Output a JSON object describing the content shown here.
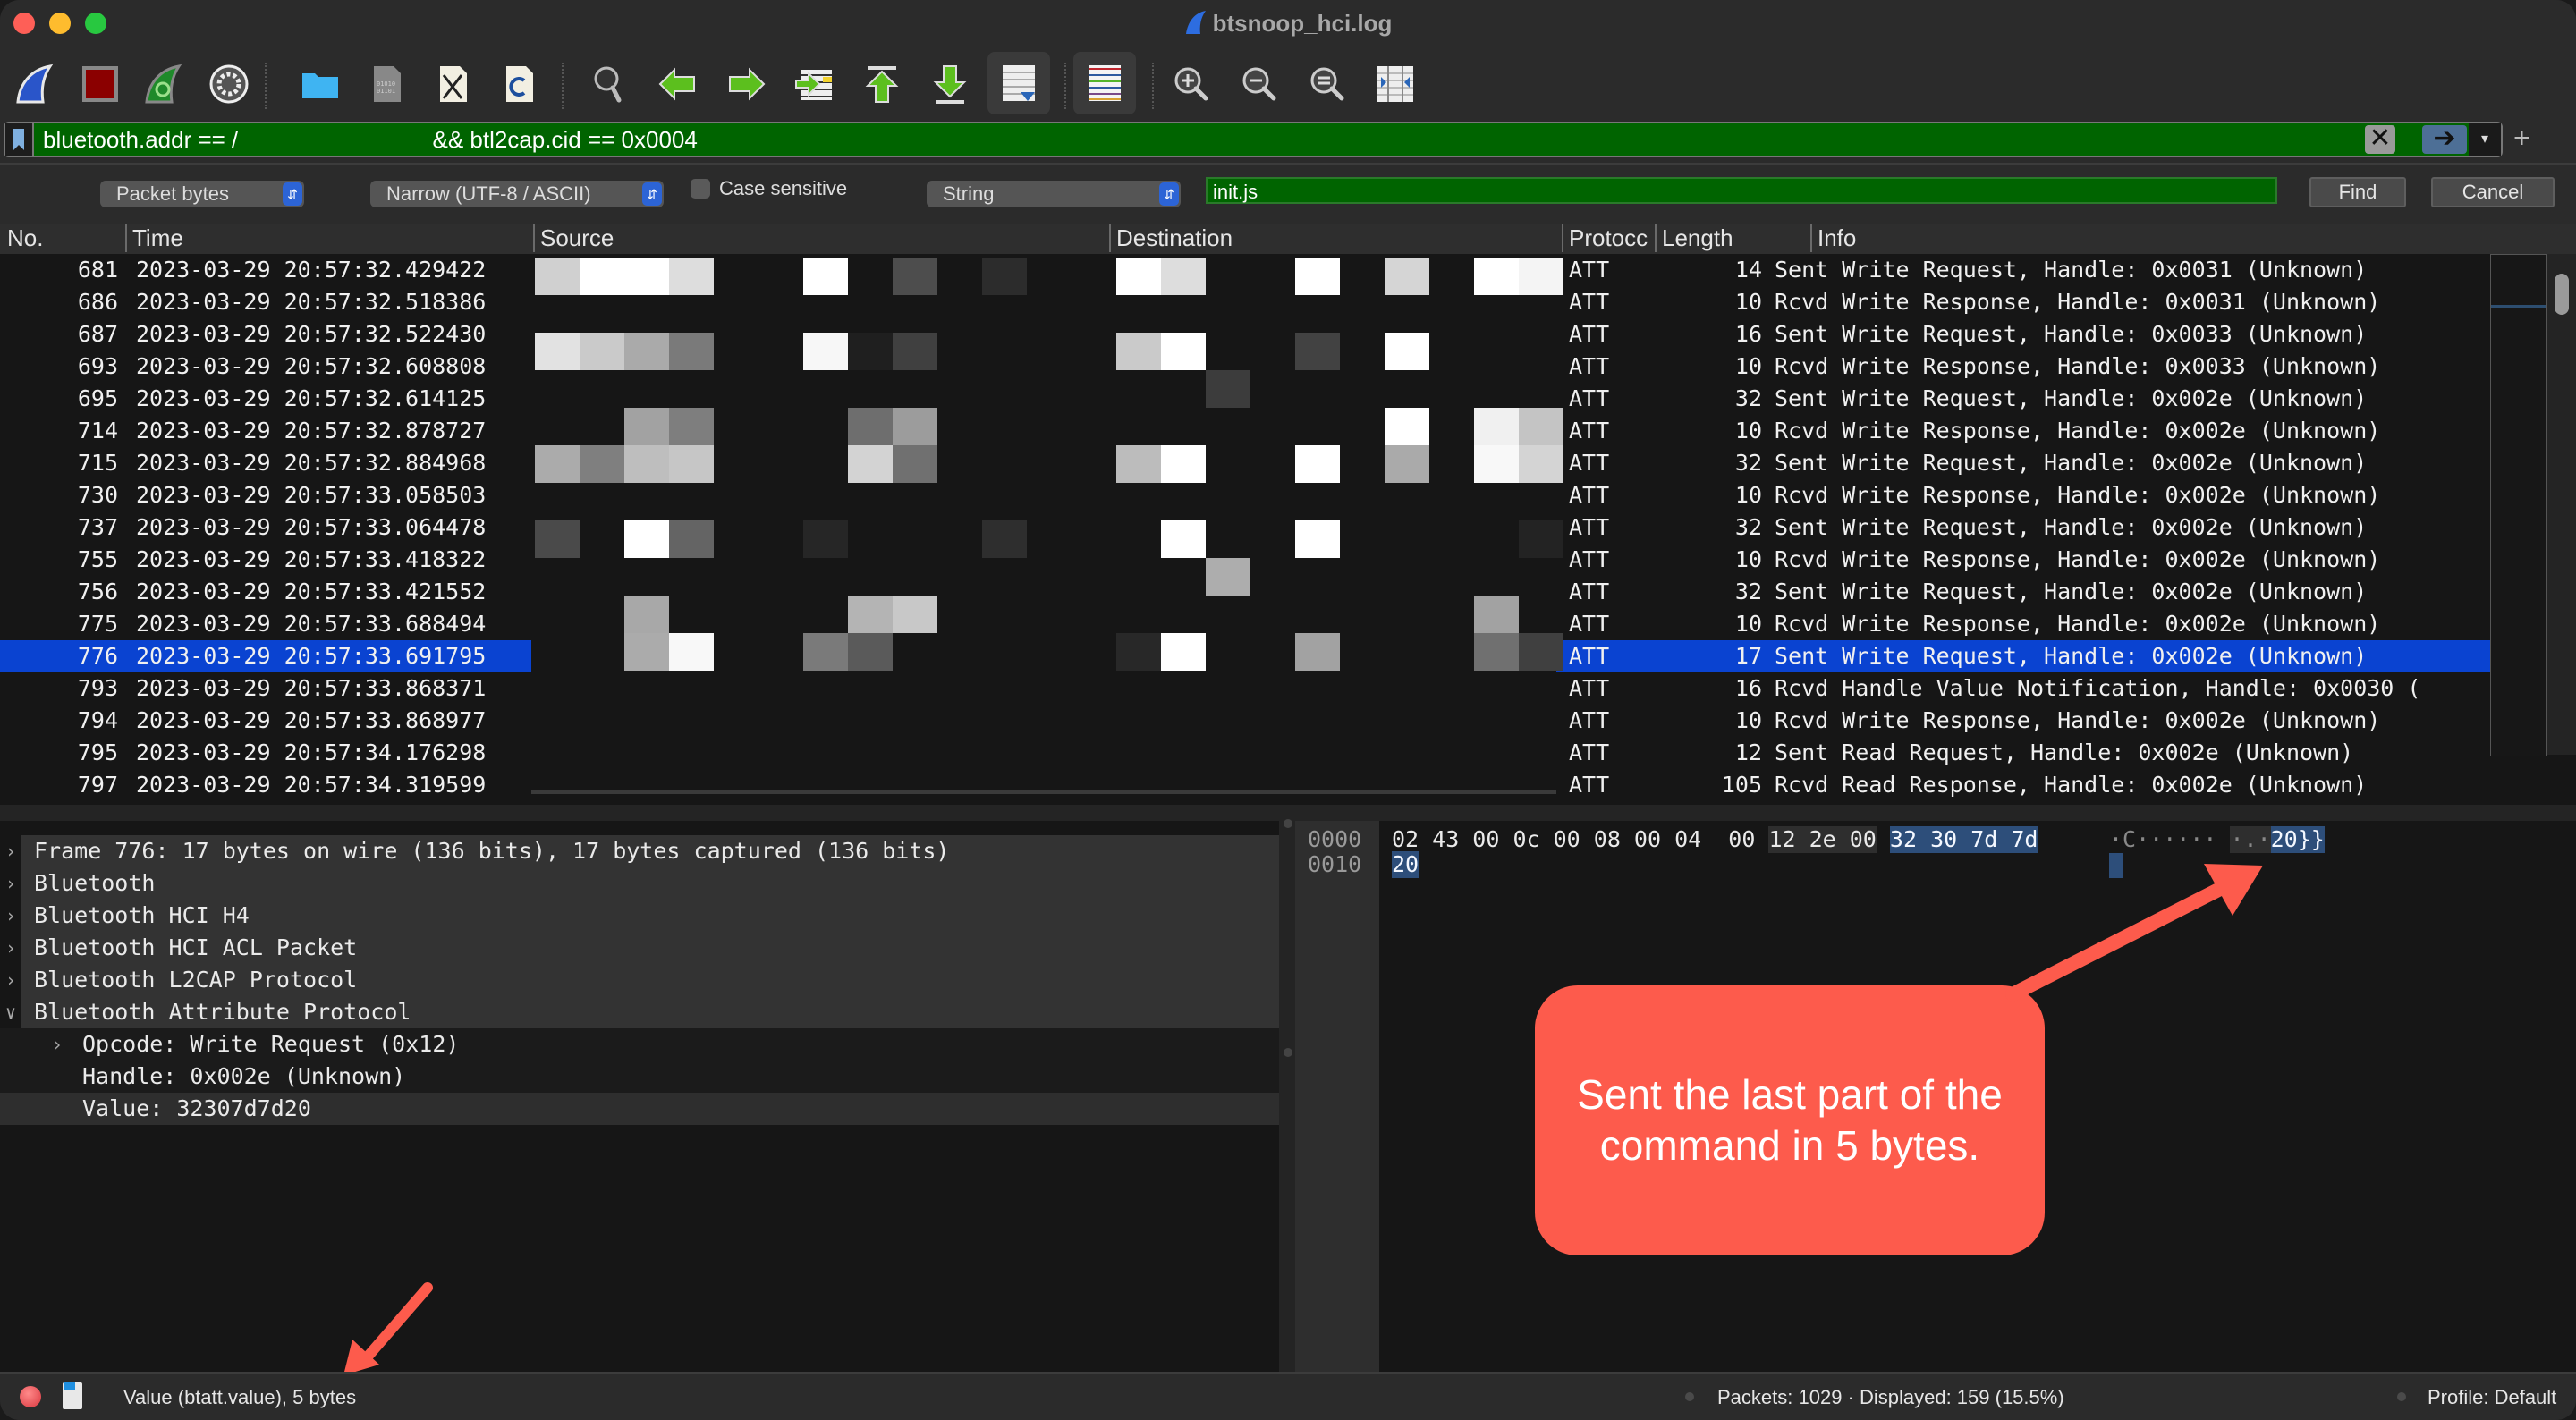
{
  "window": {
    "title": "btsnoop_hci.log"
  },
  "toolbar": {
    "buttons": [
      {
        "name": "start-capture",
        "icon": "shark-fin-icon"
      },
      {
        "name": "stop-capture",
        "icon": "stop-square-icon"
      },
      {
        "name": "restart-capture",
        "icon": "restart-fin-icon"
      },
      {
        "name": "capture-options",
        "icon": "gear-icon"
      },
      {
        "name": "open-file",
        "icon": "folder-icon"
      },
      {
        "name": "save-file",
        "icon": "binary-file-icon"
      },
      {
        "name": "close-file",
        "icon": "close-file-icon"
      },
      {
        "name": "reload-file",
        "icon": "reload-file-icon"
      },
      {
        "name": "find-packet",
        "icon": "magnifier-icon"
      },
      {
        "name": "go-back",
        "icon": "arrow-left-icon"
      },
      {
        "name": "go-forward",
        "icon": "arrow-right-icon"
      },
      {
        "name": "go-to-packet",
        "icon": "jump-to-packet-icon"
      },
      {
        "name": "go-first",
        "icon": "arrow-up-first-icon"
      },
      {
        "name": "go-last",
        "icon": "arrow-down-last-icon"
      },
      {
        "name": "auto-scroll",
        "icon": "auto-scroll-icon",
        "pressed": true
      },
      {
        "name": "colorize",
        "icon": "colorize-lines-icon",
        "pressed": true
      },
      {
        "name": "zoom-in",
        "icon": "zoom-in-icon"
      },
      {
        "name": "zoom-out",
        "icon": "zoom-out-icon"
      },
      {
        "name": "normal-size",
        "icon": "zoom-reset-icon"
      },
      {
        "name": "resize-columns",
        "icon": "resize-columns-icon"
      }
    ]
  },
  "filter": {
    "prefix": "bluetooth.addr == /",
    "suffix": " && btl2cap.cid == 0x0004",
    "clear_icon": "✕",
    "apply_icon": "➔",
    "dropdown_icon": "▾",
    "add_icon": "+"
  },
  "find": {
    "search_in": "Packet bytes",
    "char_width": "Narrow (UTF-8 / ASCII)",
    "case_sensitive_label": "Case sensitive",
    "case_sensitive": false,
    "search_type": "String",
    "query": "init.js",
    "find_label": "Find",
    "cancel_label": "Cancel"
  },
  "packet_list": {
    "columns": [
      "No.",
      "Time",
      "Source",
      "Destination",
      "Protocc",
      "Length",
      "Info"
    ],
    "selected_no": "776",
    "rows": [
      {
        "no": "681",
        "time": "2023-03-29 20:57:32.429422",
        "proto": "ATT",
        "len": "14",
        "info": "Sent Write Request, Handle: 0x0031 (Unknown)"
      },
      {
        "no": "686",
        "time": "2023-03-29 20:57:32.518386",
        "proto": "ATT",
        "len": "10",
        "info": "Rcvd Write Response, Handle: 0x0031 (Unknown)"
      },
      {
        "no": "687",
        "time": "2023-03-29 20:57:32.522430",
        "proto": "ATT",
        "len": "16",
        "info": "Sent Write Request, Handle: 0x0033 (Unknown)"
      },
      {
        "no": "693",
        "time": "2023-03-29 20:57:32.608808",
        "proto": "ATT",
        "len": "10",
        "info": "Rcvd Write Response, Handle: 0x0033 (Unknown)"
      },
      {
        "no": "695",
        "time": "2023-03-29 20:57:32.614125",
        "proto": "ATT",
        "len": "32",
        "info": "Sent Write Request, Handle: 0x002e (Unknown)"
      },
      {
        "no": "714",
        "time": "2023-03-29 20:57:32.878727",
        "proto": "ATT",
        "len": "10",
        "info": "Rcvd Write Response, Handle: 0x002e (Unknown)"
      },
      {
        "no": "715",
        "time": "2023-03-29 20:57:32.884968",
        "proto": "ATT",
        "len": "32",
        "info": "Sent Write Request, Handle: 0x002e (Unknown)"
      },
      {
        "no": "730",
        "time": "2023-03-29 20:57:33.058503",
        "proto": "ATT",
        "len": "10",
        "info": "Rcvd Write Response, Handle: 0x002e (Unknown)"
      },
      {
        "no": "737",
        "time": "2023-03-29 20:57:33.064478",
        "proto": "ATT",
        "len": "32",
        "info": "Sent Write Request, Handle: 0x002e (Unknown)"
      },
      {
        "no": "755",
        "time": "2023-03-29 20:57:33.418322",
        "proto": "ATT",
        "len": "10",
        "info": "Rcvd Write Response, Handle: 0x002e (Unknown)"
      },
      {
        "no": "756",
        "time": "2023-03-29 20:57:33.421552",
        "proto": "ATT",
        "len": "32",
        "info": "Sent Write Request, Handle: 0x002e (Unknown)"
      },
      {
        "no": "775",
        "time": "2023-03-29 20:57:33.688494",
        "proto": "ATT",
        "len": "10",
        "info": "Rcvd Write Response, Handle: 0x002e (Unknown)"
      },
      {
        "no": "776",
        "time": "2023-03-29 20:57:33.691795",
        "proto": "ATT",
        "len": "17",
        "info": "Sent Write Request, Handle: 0x002e (Unknown)"
      },
      {
        "no": "793",
        "time": "2023-03-29 20:57:33.868371",
        "proto": "ATT",
        "len": "16",
        "info": "Rcvd Handle Value Notification, Handle: 0x0030 ("
      },
      {
        "no": "794",
        "time": "2023-03-29 20:57:33.868977",
        "proto": "ATT",
        "len": "10",
        "info": "Rcvd Write Response, Handle: 0x002e (Unknown)"
      },
      {
        "no": "795",
        "time": "2023-03-29 20:57:34.176298",
        "proto": "ATT",
        "len": "12",
        "info": "Sent Read Request, Handle: 0x002e (Unknown)"
      },
      {
        "no": "797",
        "time": "2023-03-29 20:57:34.319599",
        "proto": "ATT",
        "len": "105",
        "info": "Rcvd Read Response, Handle: 0x002e (Unknown)"
      }
    ]
  },
  "details": {
    "items": [
      {
        "label": "Frame 776: 17 bytes on wire (136 bits), 17 bytes captured (136 bits)",
        "expander": "›",
        "level": 0
      },
      {
        "label": "Bluetooth",
        "expander": "›",
        "level": 0
      },
      {
        "label": "Bluetooth HCI H4",
        "expander": "›",
        "level": 0
      },
      {
        "label": "Bluetooth HCI ACL Packet",
        "expander": "›",
        "level": 0
      },
      {
        "label": "Bluetooth L2CAP Protocol",
        "expander": "›",
        "level": 0
      },
      {
        "label": "Bluetooth Attribute Protocol",
        "expander": "∨",
        "level": 0
      },
      {
        "label": "Opcode: Write Request (0x12)",
        "expander": "›",
        "level": 1
      },
      {
        "label": "Handle: 0x002e (Unknown)",
        "expander": "",
        "level": 1
      },
      {
        "label": "Value: 32307d7d20",
        "expander": "",
        "level": 1,
        "selected": true
      }
    ]
  },
  "bytes": {
    "offsets": [
      "0000",
      "0010"
    ],
    "line0": {
      "a": "02 43 00 0c 00 08 00 04  00 ",
      "b": "12 2e 00",
      "c": " ",
      "d": "32 30 7d 7d"
    },
    "line1": {
      "d": "20"
    },
    "ascii0": {
      "a": "·C······ ",
      "b": "·.·",
      "d": "20}}"
    }
  },
  "annotation": {
    "text": "Sent the last part of the command in 5 bytes.",
    "color": "#fd5b4c"
  },
  "status": {
    "field_info": "Value (btatt.value), 5 bytes",
    "packets": "Packets: 1029 · Displayed: 159 (15.5%)",
    "profile": "Profile: Default"
  },
  "colors": {
    "filter_valid": "#006400",
    "selection": "#0a43d1",
    "byte_highlight": "#2d4e7a",
    "annotation": "#fd5b4c"
  }
}
